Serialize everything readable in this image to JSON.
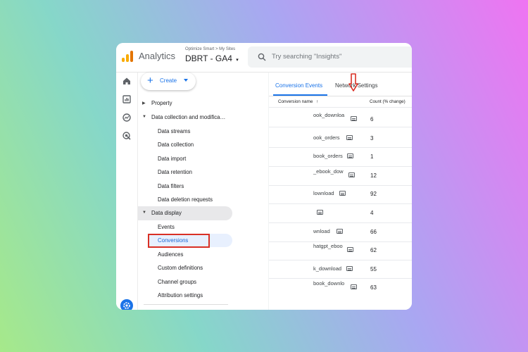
{
  "header": {
    "app_title": "Analytics",
    "breadcrumb": "Optimize Smart > My Sites",
    "property": "DBRT - GA4",
    "search_placeholder": "Try searching \"Insights\""
  },
  "rail": {
    "icons": [
      "home-icon",
      "reports-icon",
      "explore-icon",
      "advertising-icon",
      "settings-icon"
    ]
  },
  "nav": {
    "create_label": "Create",
    "items": [
      {
        "label": "Property",
        "type": "group"
      },
      {
        "label": "Data collection and modifica…",
        "type": "group"
      },
      {
        "label": "Data streams"
      },
      {
        "label": "Data collection"
      },
      {
        "label": "Data import"
      },
      {
        "label": "Data retention"
      },
      {
        "label": "Data filters"
      },
      {
        "label": "Data deletion requests"
      },
      {
        "label": "Data display",
        "type": "group"
      },
      {
        "label": "Events"
      },
      {
        "label": "Conversions",
        "selected": true
      },
      {
        "label": "Audiences"
      },
      {
        "label": "Custom definitions"
      },
      {
        "label": "Channel groups"
      },
      {
        "label": "Attribution settings"
      }
    ]
  },
  "panel": {
    "tabs": [
      "Conversion Events",
      "Network Settings"
    ],
    "active_tab": "Conversion Events",
    "columns": [
      "Conversion name",
      "Count (% change)"
    ],
    "rows": [
      {
        "name": "ook_downloa",
        "count": "6"
      },
      {
        "name": "ook_orders",
        "count": "3"
      },
      {
        "name": "book_orders",
        "count": "1"
      },
      {
        "name": "_ebook_dow",
        "count": "12"
      },
      {
        "name": "lownload",
        "count": "92"
      },
      {
        "name": "",
        "count": "4"
      },
      {
        "name": "wnload",
        "count": "66"
      },
      {
        "name": "hatgpt_eboo",
        "count": "62"
      },
      {
        "name": "k_download",
        "count": "55"
      },
      {
        "name": "book_downlo",
        "count": "63"
      }
    ]
  },
  "colors": {
    "accent": "#1a73e8",
    "highlight_red": "#d93025",
    "logo": "#f9ab00"
  }
}
